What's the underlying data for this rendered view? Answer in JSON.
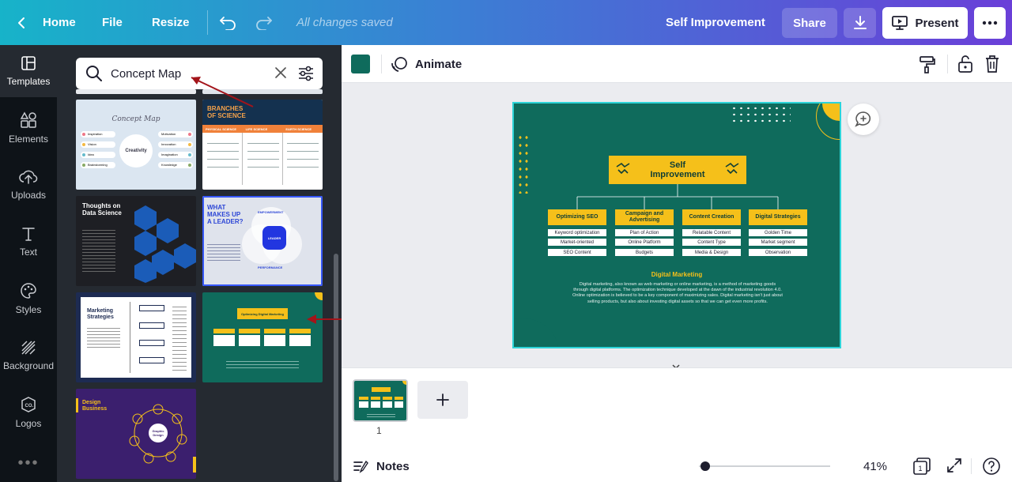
{
  "topbar": {
    "home": "Home",
    "file": "File",
    "resize": "Resize",
    "saved_status": "All changes saved",
    "doc_title": "Self Improvement",
    "share": "Share",
    "present": "Present"
  },
  "rail": {
    "items": [
      {
        "label": "Templates",
        "icon": "templates-icon"
      },
      {
        "label": "Elements",
        "icon": "elements-icon"
      },
      {
        "label": "Uploads",
        "icon": "uploads-icon"
      },
      {
        "label": "Text",
        "icon": "text-icon"
      },
      {
        "label": "Styles",
        "icon": "styles-icon"
      },
      {
        "label": "Background",
        "icon": "background-icon"
      },
      {
        "label": "Logos",
        "icon": "logos-icon"
      }
    ]
  },
  "search": {
    "value": "Concept Map"
  },
  "thumbs": {
    "concept_map": {
      "title": "Concept Map",
      "center": "Creativity",
      "left": [
        "Inspiration",
        "Vision",
        "Idea",
        "Brainstorming"
      ],
      "right": [
        "Motivation",
        "Innovation",
        "Imagination",
        "Knowledge"
      ]
    },
    "branches": {
      "title_1": "BRANCHES",
      "title_2": "OF SCIENCE",
      "cols": [
        "PHYSICAL SCIENCE",
        "LIFE SCIENCE",
        "EARTH SCIENCE"
      ]
    },
    "thoughts": {
      "title": "Thoughts on Data Science"
    },
    "leader": {
      "title": "WHAT MAKES UP A LEADER?",
      "center": "LEADER",
      "top": "EMPOWERMENT",
      "bottom": "PERFORMANCE"
    },
    "marketing": {
      "title": "Marketing Strategies"
    },
    "digital": {
      "title": "Optimizing Digital Marketing"
    },
    "design_business": {
      "title": "Design Business",
      "center": "Graphic Design"
    }
  },
  "toolbar": {
    "animate": "Animate",
    "color": "#0f6b5c"
  },
  "slide": {
    "title": "Self Improvement",
    "columns": [
      {
        "head": "Optimizing SEO",
        "cells": [
          "Keyword optimization",
          "Market-oriented",
          "SEO Content"
        ]
      },
      {
        "head": "Campaign and Advertising",
        "cells": [
          "Plan of Action",
          "Online Platform",
          "Budgets"
        ]
      },
      {
        "head": "Content Creation",
        "cells": [
          "Relatable Content",
          "Content Type",
          "Media & Design"
        ]
      },
      {
        "head": "Digital Strategies",
        "cells": [
          "Golden Time",
          "Market segment",
          "Observation"
        ]
      }
    ],
    "subtitle": "Digital Marketing",
    "description": "Digital marketing, also known as web marketing or online marketing, is a method of marketing goods through digital platforms. The optimization technique developed at the dawn of the industrial revolution 4.0. Online optimization is believed to be a key component of maximizing sales. Digital marketing isn't just about selling products, but also about investing digital assets so that we can get even more profits."
  },
  "pages": {
    "current": "1"
  },
  "bottombar": {
    "notes": "Notes",
    "zoom": "41%",
    "page_count": "1"
  }
}
